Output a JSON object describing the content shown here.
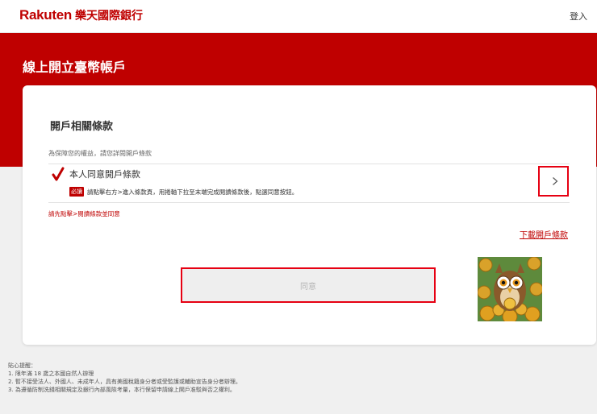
{
  "header": {
    "logo_en": "Rakuten",
    "logo_zh": "樂天國際銀行",
    "login_label": "登入"
  },
  "page": {
    "title": "線上開立臺幣帳戶"
  },
  "terms_section": {
    "title": "開戶相關條款",
    "intro": "為保障您的權益，請您詳閱開戶條款",
    "item_label": "本人同意開戶條款",
    "required_badge": "必讀",
    "item_hint": "請點擊右方>進入條款頁，用捲軸下拉至末端完成閱讀條款後，點選同意按鈕。",
    "error": "請先點擊>閱讀條款並同意",
    "download_label": "下載開戶條款",
    "agree_label": "同意"
  },
  "notes": {
    "heading": "貼心提醒：",
    "items": [
      "1. 限年滿 18 歲之本國自然人辦理",
      "2. 暫不接受法人、外國人、未成年人，具有美國稅籍身分者或受監護或輔助宣告身分者辦理。",
      "3. 為遵循防制洗錢相關規定及銀行內部風險考量，本行保留申請線上開戶准駁與否之權利。"
    ]
  },
  "colors": {
    "brand_red": "#bf0000",
    "highlight_red": "#e60012",
    "owl_background": "#5e8a3c",
    "coin_gold": "#e0a020"
  },
  "icons": {
    "check": "check-icon",
    "chevron": "chevron-right-icon",
    "owl": "owl-illustration"
  }
}
